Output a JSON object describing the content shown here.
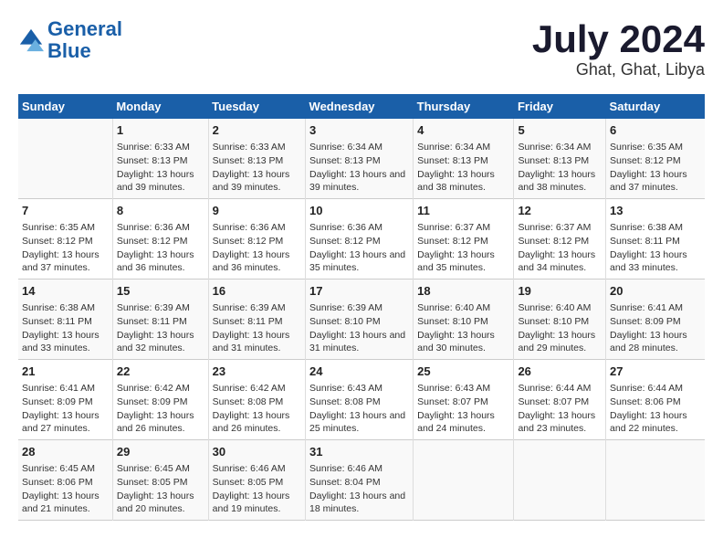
{
  "header": {
    "logo_line1": "General",
    "logo_line2": "Blue",
    "main_title": "July 2024",
    "subtitle": "Ghat, Ghat, Libya"
  },
  "days_of_week": [
    "Sunday",
    "Monday",
    "Tuesday",
    "Wednesday",
    "Thursday",
    "Friday",
    "Saturday"
  ],
  "weeks": [
    [
      {
        "day": "",
        "sunrise": "",
        "sunset": "",
        "daylight": ""
      },
      {
        "day": "1",
        "sunrise": "Sunrise: 6:33 AM",
        "sunset": "Sunset: 8:13 PM",
        "daylight": "Daylight: 13 hours and 39 minutes."
      },
      {
        "day": "2",
        "sunrise": "Sunrise: 6:33 AM",
        "sunset": "Sunset: 8:13 PM",
        "daylight": "Daylight: 13 hours and 39 minutes."
      },
      {
        "day": "3",
        "sunrise": "Sunrise: 6:34 AM",
        "sunset": "Sunset: 8:13 PM",
        "daylight": "Daylight: 13 hours and 39 minutes."
      },
      {
        "day": "4",
        "sunrise": "Sunrise: 6:34 AM",
        "sunset": "Sunset: 8:13 PM",
        "daylight": "Daylight: 13 hours and 38 minutes."
      },
      {
        "day": "5",
        "sunrise": "Sunrise: 6:34 AM",
        "sunset": "Sunset: 8:13 PM",
        "daylight": "Daylight: 13 hours and 38 minutes."
      },
      {
        "day": "6",
        "sunrise": "Sunrise: 6:35 AM",
        "sunset": "Sunset: 8:12 PM",
        "daylight": "Daylight: 13 hours and 37 minutes."
      }
    ],
    [
      {
        "day": "7",
        "sunrise": "Sunrise: 6:35 AM",
        "sunset": "Sunset: 8:12 PM",
        "daylight": "Daylight: 13 hours and 37 minutes."
      },
      {
        "day": "8",
        "sunrise": "Sunrise: 6:36 AM",
        "sunset": "Sunset: 8:12 PM",
        "daylight": "Daylight: 13 hours and 36 minutes."
      },
      {
        "day": "9",
        "sunrise": "Sunrise: 6:36 AM",
        "sunset": "Sunset: 8:12 PM",
        "daylight": "Daylight: 13 hours and 36 minutes."
      },
      {
        "day": "10",
        "sunrise": "Sunrise: 6:36 AM",
        "sunset": "Sunset: 8:12 PM",
        "daylight": "Daylight: 13 hours and 35 minutes."
      },
      {
        "day": "11",
        "sunrise": "Sunrise: 6:37 AM",
        "sunset": "Sunset: 8:12 PM",
        "daylight": "Daylight: 13 hours and 35 minutes."
      },
      {
        "day": "12",
        "sunrise": "Sunrise: 6:37 AM",
        "sunset": "Sunset: 8:12 PM",
        "daylight": "Daylight: 13 hours and 34 minutes."
      },
      {
        "day": "13",
        "sunrise": "Sunrise: 6:38 AM",
        "sunset": "Sunset: 8:11 PM",
        "daylight": "Daylight: 13 hours and 33 minutes."
      }
    ],
    [
      {
        "day": "14",
        "sunrise": "Sunrise: 6:38 AM",
        "sunset": "Sunset: 8:11 PM",
        "daylight": "Daylight: 13 hours and 33 minutes."
      },
      {
        "day": "15",
        "sunrise": "Sunrise: 6:39 AM",
        "sunset": "Sunset: 8:11 PM",
        "daylight": "Daylight: 13 hours and 32 minutes."
      },
      {
        "day": "16",
        "sunrise": "Sunrise: 6:39 AM",
        "sunset": "Sunset: 8:11 PM",
        "daylight": "Daylight: 13 hours and 31 minutes."
      },
      {
        "day": "17",
        "sunrise": "Sunrise: 6:39 AM",
        "sunset": "Sunset: 8:10 PM",
        "daylight": "Daylight: 13 hours and 31 minutes."
      },
      {
        "day": "18",
        "sunrise": "Sunrise: 6:40 AM",
        "sunset": "Sunset: 8:10 PM",
        "daylight": "Daylight: 13 hours and 30 minutes."
      },
      {
        "day": "19",
        "sunrise": "Sunrise: 6:40 AM",
        "sunset": "Sunset: 8:10 PM",
        "daylight": "Daylight: 13 hours and 29 minutes."
      },
      {
        "day": "20",
        "sunrise": "Sunrise: 6:41 AM",
        "sunset": "Sunset: 8:09 PM",
        "daylight": "Daylight: 13 hours and 28 minutes."
      }
    ],
    [
      {
        "day": "21",
        "sunrise": "Sunrise: 6:41 AM",
        "sunset": "Sunset: 8:09 PM",
        "daylight": "Daylight: 13 hours and 27 minutes."
      },
      {
        "day": "22",
        "sunrise": "Sunrise: 6:42 AM",
        "sunset": "Sunset: 8:09 PM",
        "daylight": "Daylight: 13 hours and 26 minutes."
      },
      {
        "day": "23",
        "sunrise": "Sunrise: 6:42 AM",
        "sunset": "Sunset: 8:08 PM",
        "daylight": "Daylight: 13 hours and 26 minutes."
      },
      {
        "day": "24",
        "sunrise": "Sunrise: 6:43 AM",
        "sunset": "Sunset: 8:08 PM",
        "daylight": "Daylight: 13 hours and 25 minutes."
      },
      {
        "day": "25",
        "sunrise": "Sunrise: 6:43 AM",
        "sunset": "Sunset: 8:07 PM",
        "daylight": "Daylight: 13 hours and 24 minutes."
      },
      {
        "day": "26",
        "sunrise": "Sunrise: 6:44 AM",
        "sunset": "Sunset: 8:07 PM",
        "daylight": "Daylight: 13 hours and 23 minutes."
      },
      {
        "day": "27",
        "sunrise": "Sunrise: 6:44 AM",
        "sunset": "Sunset: 8:06 PM",
        "daylight": "Daylight: 13 hours and 22 minutes."
      }
    ],
    [
      {
        "day": "28",
        "sunrise": "Sunrise: 6:45 AM",
        "sunset": "Sunset: 8:06 PM",
        "daylight": "Daylight: 13 hours and 21 minutes."
      },
      {
        "day": "29",
        "sunrise": "Sunrise: 6:45 AM",
        "sunset": "Sunset: 8:05 PM",
        "daylight": "Daylight: 13 hours and 20 minutes."
      },
      {
        "day": "30",
        "sunrise": "Sunrise: 6:46 AM",
        "sunset": "Sunset: 8:05 PM",
        "daylight": "Daylight: 13 hours and 19 minutes."
      },
      {
        "day": "31",
        "sunrise": "Sunrise: 6:46 AM",
        "sunset": "Sunset: 8:04 PM",
        "daylight": "Daylight: 13 hours and 18 minutes."
      },
      {
        "day": "",
        "sunrise": "",
        "sunset": "",
        "daylight": ""
      },
      {
        "day": "",
        "sunrise": "",
        "sunset": "",
        "daylight": ""
      },
      {
        "day": "",
        "sunrise": "",
        "sunset": "",
        "daylight": ""
      }
    ]
  ]
}
